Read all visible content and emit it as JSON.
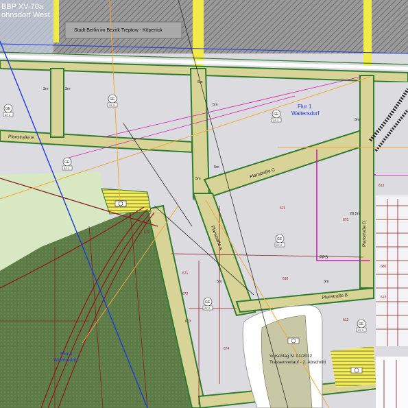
{
  "header": {
    "plan_id": "BBP XV-70a",
    "plan_name": "ohnsdorf West",
    "authority": "Stadt Berlin im Bezirk Treptow - Köpenick"
  },
  "flur": {
    "name": "Flur 1",
    "district": "Waltersdorf"
  },
  "lower_left_flur": {
    "name": "Flur 1",
    "district": "Waltersdorf"
  },
  "streets": {
    "e": "Planstraße E",
    "c": "Planstraße C",
    "a": "Planstraße A",
    "b": "Planstraße B",
    "d": "Planstraße D"
  },
  "zone_badges": [
    {
      "top": "GE",
      "bottom": "ZF 2"
    },
    {
      "top": "GE",
      "bottom": "ZF 2"
    },
    {
      "top": "GE",
      "bottom": "ZF 2"
    },
    {
      "top": "GE",
      "bottom": "ZF 2"
    },
    {
      "top": "GE",
      "bottom": "ZF 2"
    },
    {
      "top": "GE",
      "bottom": "ZF 2"
    },
    {
      "top": "GE",
      "bottom": "ZF 2"
    }
  ],
  "measures": [
    "3m",
    "3m",
    "5m",
    "5m",
    "3m",
    "5m",
    "5m",
    "5m",
    "28.5m",
    "3m"
  ],
  "parcels": [
    "610",
    "611",
    "612",
    "613",
    "670",
    "671",
    "672",
    "673",
    "674",
    "675",
    "680",
    "612"
  ],
  "annotation": "Vorschlag N: 01/2012",
  "annotation_sub": "Trassenverlauf - 2. Abschnitt",
  "pps_label": "PPS",
  "colors": {
    "gray_area": "#dcdce0",
    "green_area": "#5f7d48",
    "street_fill": "#d8d397",
    "green_strip": "#2f7b2f",
    "yellow": "#f1ea48",
    "magenta": "#d21bb4",
    "orange": "#f2a83a",
    "blue": "#1f38e0",
    "brown": "#8b1d1d"
  }
}
